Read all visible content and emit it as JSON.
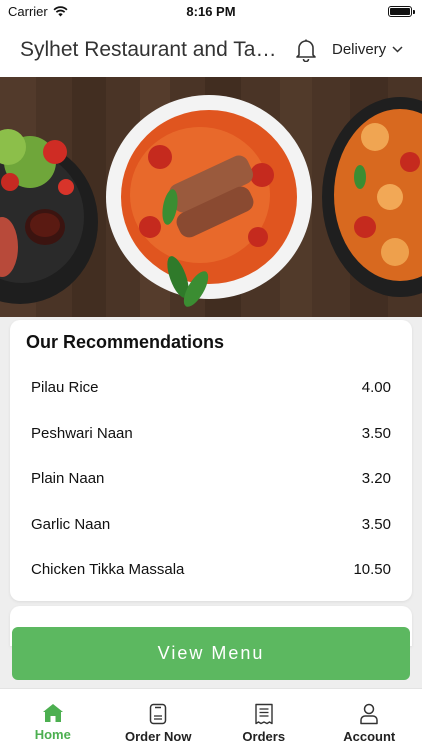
{
  "status_bar": {
    "carrier": "Carrier",
    "time": "8:16 PM"
  },
  "header": {
    "title": "Sylhet Restaurant and Takeaway",
    "delivery_mode": "Delivery"
  },
  "recommendations": {
    "title": "Our Recommendations",
    "items": [
      {
        "name": "Pilau Rice",
        "price": "4.00"
      },
      {
        "name": "Peshwari Naan",
        "price": "3.50"
      },
      {
        "name": "Plain Naan",
        "price": "3.20"
      },
      {
        "name": "Garlic Naan",
        "price": "3.50"
      },
      {
        "name": "Chicken Tikka Massala",
        "price": "10.50"
      }
    ]
  },
  "cta": {
    "view_menu": "View Menu"
  },
  "tabs": [
    {
      "label": "Home",
      "icon": "home-icon",
      "active": true
    },
    {
      "label": "Order Now",
      "icon": "order-icon",
      "active": false
    },
    {
      "label": "Orders",
      "icon": "receipt-icon",
      "active": false
    },
    {
      "label": "Account",
      "icon": "account-icon",
      "active": false
    }
  ],
  "colors": {
    "accent": "#5cb860",
    "active_tab": "#4caf50"
  }
}
